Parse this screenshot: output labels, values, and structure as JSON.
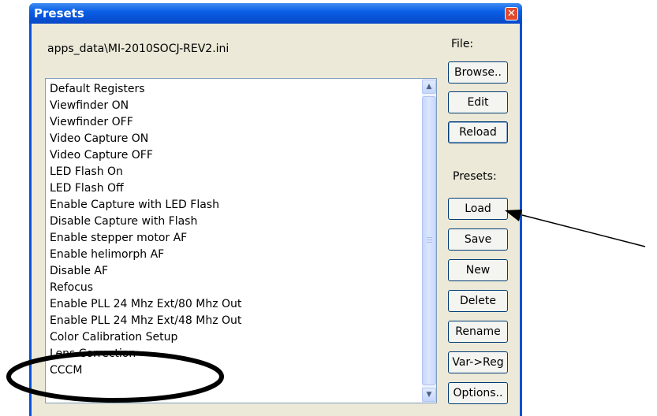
{
  "window": {
    "title": "Presets"
  },
  "file_path": "apps_data\\MI-2010SOCJ-REV2.ini",
  "labels": {
    "file": "File:",
    "presets": "Presets:"
  },
  "presets_list": [
    "Default Registers",
    "Viewfinder ON",
    "Viewfinder OFF",
    "Video Capture ON",
    "Video Capture OFF",
    "LED Flash On",
    "LED Flash Off",
    "Enable Capture with LED Flash",
    "Disable Capture with Flash",
    "Enable stepper motor AF",
    "Enable helimorph AF",
    "Disable AF",
    "Refocus",
    "Enable PLL 24 Mhz Ext/80 Mhz Out",
    "Enable PLL 24 Mhz Ext/48 Mhz Out",
    "Color Calibration Setup",
    "Lens Correction",
    "CCCM"
  ],
  "file_buttons": {
    "browse": "Browse..",
    "edit": "Edit",
    "reload": "Reload"
  },
  "preset_buttons": {
    "load": "Load",
    "save": "Save",
    "new": "New",
    "delete": "Delete",
    "rename": "Rename",
    "var_reg": "Var->Reg",
    "options": "Options.."
  },
  "colors": {
    "title_bar": "#0a5fe6",
    "client_bg": "#ece9d8",
    "close_button": "#e24a2b",
    "annotation": "#000000"
  }
}
